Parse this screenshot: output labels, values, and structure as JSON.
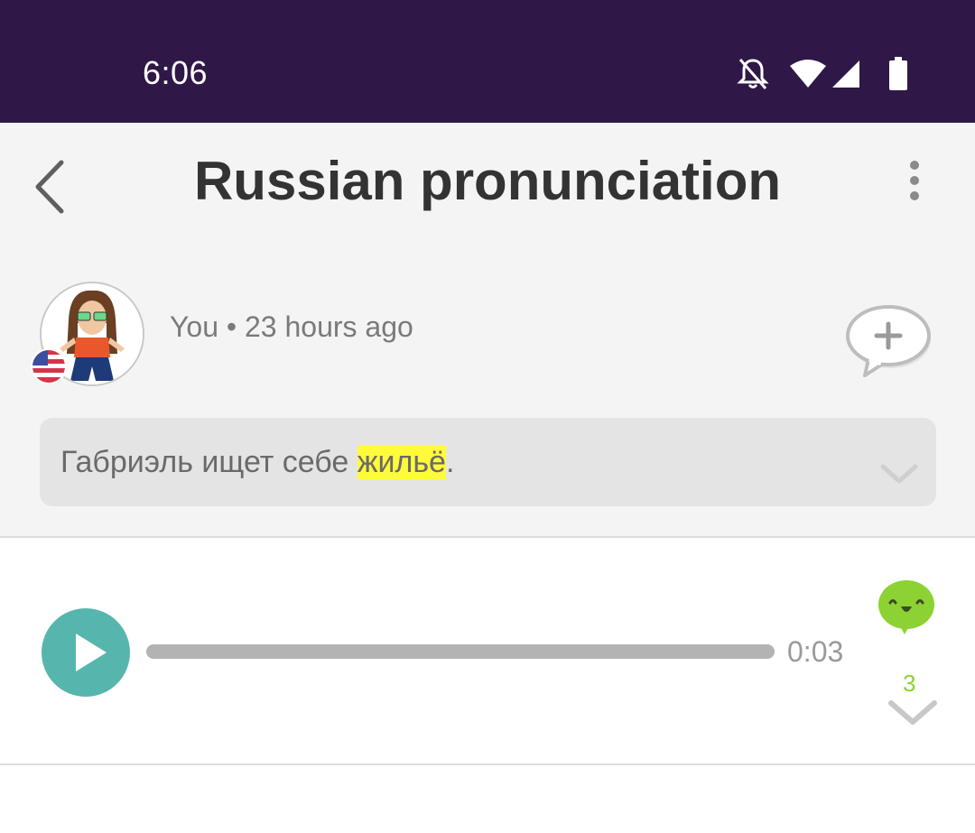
{
  "status_bar": {
    "time": "6:06",
    "icons": [
      "notifications-off-icon",
      "wifi-icon",
      "cell-signal-icon",
      "battery-icon"
    ]
  },
  "header": {
    "title": "Russian pronunciation",
    "back_icon": "chevron-left-icon",
    "menu_icon": "more-vertical-icon"
  },
  "post": {
    "author": "You",
    "separator": "•",
    "time_ago": "23 hours ago",
    "flag": "us-flag-icon",
    "add_comment_icon": "add-comment-bubble-icon",
    "sentence_before": "Габриэль ищет себе ",
    "sentence_highlight": "жильё",
    "sentence_after": ".",
    "highlight_color": "#fffb3a"
  },
  "audio": {
    "duration": "0:03",
    "progress": 0,
    "reaction_icon": "happy-bubble-icon",
    "reaction_count": "3",
    "accent_color": "#56b6ad",
    "reaction_color": "#8cd232"
  }
}
